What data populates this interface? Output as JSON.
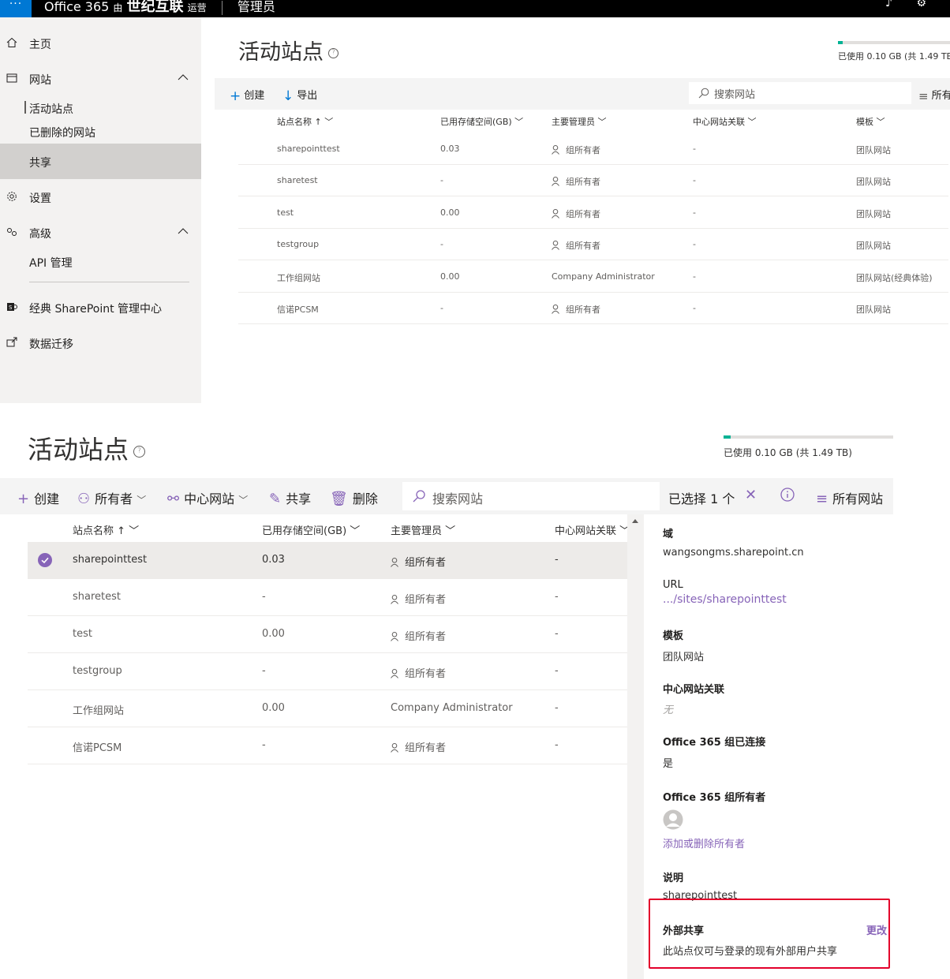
{
  "topbar": {
    "product": "Office 365",
    "org_name": "世纪互联",
    "org_suffix": "运营",
    "mid_text": "由",
    "section": "管理员"
  },
  "sidebar": {
    "items": [
      {
        "label": "主页"
      },
      {
        "label": "网站"
      },
      {
        "label": "活动站点"
      },
      {
        "label": "已删除的网站"
      },
      {
        "label": "共享"
      },
      {
        "label": "设置"
      },
      {
        "label": "高级"
      },
      {
        "label": "API 管理"
      },
      {
        "label": "经典 SharePoint 管理中心"
      },
      {
        "label": "数据迁移"
      }
    ]
  },
  "page": {
    "title": "活动站点",
    "help_glyph": "?",
    "storage_text": "已使用 0.10 GB (共 1.49 TB)",
    "storage_fraction": 0.04
  },
  "screen1": {
    "commands": {
      "create": "创建",
      "export": "导出",
      "search_placeholder": "搜索网站",
      "view": "所有"
    },
    "columns": [
      "站点名称 ↑",
      "已用存储空间(GB)",
      "主要管理员",
      "中心网站关联",
      "模板"
    ],
    "rows": [
      {
        "name": "sharepointtest",
        "storage": "0.03",
        "admin": "组所有者",
        "hub": "-",
        "template": "团队网站"
      },
      {
        "name": "sharetest",
        "storage": "-",
        "admin": "组所有者",
        "hub": "-",
        "template": "团队网站"
      },
      {
        "name": "test",
        "storage": "0.00",
        "admin": "组所有者",
        "hub": "-",
        "template": "团队网站"
      },
      {
        "name": "testgroup",
        "storage": "-",
        "admin": "组所有者",
        "hub": "-",
        "template": "团队网站"
      },
      {
        "name": "工作组网站",
        "storage": "0.00",
        "admin": "Company Administrator",
        "hub": "-",
        "template": "团队网站(经典体验)"
      },
      {
        "name": "信诺PCSM",
        "storage": "-",
        "admin": "组所有者",
        "hub": "-",
        "template": "团队网站"
      }
    ]
  },
  "screen2": {
    "commands": {
      "create": "创建",
      "owners": "所有者",
      "hub": "中心网站",
      "share": "共享",
      "delete": "删除",
      "search_placeholder": "搜索网站",
      "selected": "已选择 1 个",
      "view": "所有网站"
    },
    "columns": [
      "站点名称 ↑",
      "已用存储空间(GB)",
      "主要管理员",
      "中心网站关联"
    ],
    "rows": [
      {
        "name": "sharepointtest",
        "storage": "0.03",
        "admin": "组所有者",
        "hub": "-",
        "selected": true
      },
      {
        "name": "sharetest",
        "storage": "-",
        "admin": "组所有者",
        "hub": "-",
        "selected": false
      },
      {
        "name": "test",
        "storage": "0.00",
        "admin": "组所有者",
        "hub": "-",
        "selected": false
      },
      {
        "name": "testgroup",
        "storage": "-",
        "admin": "组所有者",
        "hub": "-",
        "selected": false
      },
      {
        "name": "工作组网站",
        "storage": "0.00",
        "admin": "Company Administrator",
        "hub": "-",
        "selected": false
      },
      {
        "name": "信诺PCSM",
        "storage": "-",
        "admin": "组所有者",
        "hub": "-",
        "selected": false
      }
    ]
  },
  "details": {
    "domain_label": "域",
    "domain_value": "wangsongms.sharepoint.cn",
    "url_label": "URL",
    "url_value": ".../sites/sharepointtest",
    "template_label": "模板",
    "template_value": "团队网站",
    "hub_label": "中心网站关联",
    "hub_value": "无",
    "group_connected_label": "Office 365 组已连接",
    "group_connected_value": "是",
    "group_owners_label": "Office 365 组所有者",
    "group_owners_link": "添加或删除所有者",
    "description_label": "说明",
    "description_value": "sharepointtest",
    "external_label": "外部共享",
    "external_change": "更改",
    "external_value": "此站点仅可与登录的现有外部用户共享"
  },
  "colors": {
    "accent_purple": "#8764b8",
    "accent_blue": "#0078d4",
    "storage_fill": "#00b294",
    "highlight": "#e3002b"
  }
}
